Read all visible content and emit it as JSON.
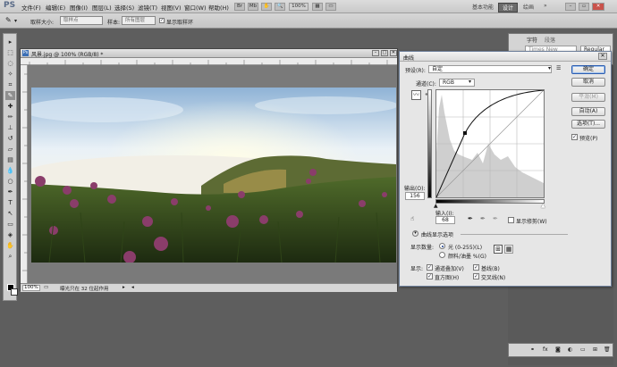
{
  "app": {
    "logo": "PS"
  },
  "menu": [
    "文件(F)",
    "编辑(E)",
    "图像(I)",
    "图层(L)",
    "选择(S)",
    "滤镜(T)",
    "视图(V)",
    "窗口(W)",
    "帮助(H)"
  ],
  "zoom": "100%",
  "workspace": {
    "basic": "基本功能",
    "design": "设计",
    "painting": "绘画",
    "more": "»"
  },
  "options": {
    "sample_size_label": "取样大小:",
    "sample_size_value": "取样点",
    "sample_label": "样本:",
    "sample_value": "所有图层",
    "show_ring": "显示取样环"
  },
  "document": {
    "title": "风景.jpg @ 100% (RGB/8) *",
    "zoom": "100%",
    "status": "曝光只在 32 位起作用"
  },
  "char_panel": {
    "tab1": "字符",
    "tab2": "段落",
    "font": "Times New Roman",
    "style": "Regular"
  },
  "curves": {
    "title": "曲线",
    "preset_label": "预设(R):",
    "preset_value": "自定",
    "channel_label": "通道(C):",
    "channel_value": "RGB",
    "output_label": "输出(O):",
    "output_value": "156",
    "input_label": "输入(I):",
    "input_value": "68",
    "show_clipping": "显示修剪(W)",
    "display_options": "曲线显示选项",
    "show_amount_label": "显示数量:",
    "light_option": "光 (0-255)(L)",
    "pigment_option": "颜料/油墨 %(G)",
    "show_label": "显示:",
    "channel_overlays": "通道叠加(V)",
    "baseline": "基线(B)",
    "histogram": "直方图(H)",
    "intersection": "交叉线(N)",
    "buttons": {
      "ok": "确定",
      "cancel": "取消",
      "smooth": "平滑(M)",
      "auto": "自动(A)",
      "options": "选项(T)...",
      "preview": "预览(P)"
    },
    "checked_mark": "✓"
  },
  "icons": [
    "pen-icon",
    "eyedropper-icon",
    "hand-icon",
    "marquee-icon",
    "lasso-icon",
    "crop-icon",
    "brush-icon",
    "stamp-icon",
    "eraser-icon",
    "gradient-icon",
    "blur-icon",
    "dodge-icon",
    "type-icon",
    "path-icon",
    "shape-icon",
    "zoom-icon"
  ]
}
